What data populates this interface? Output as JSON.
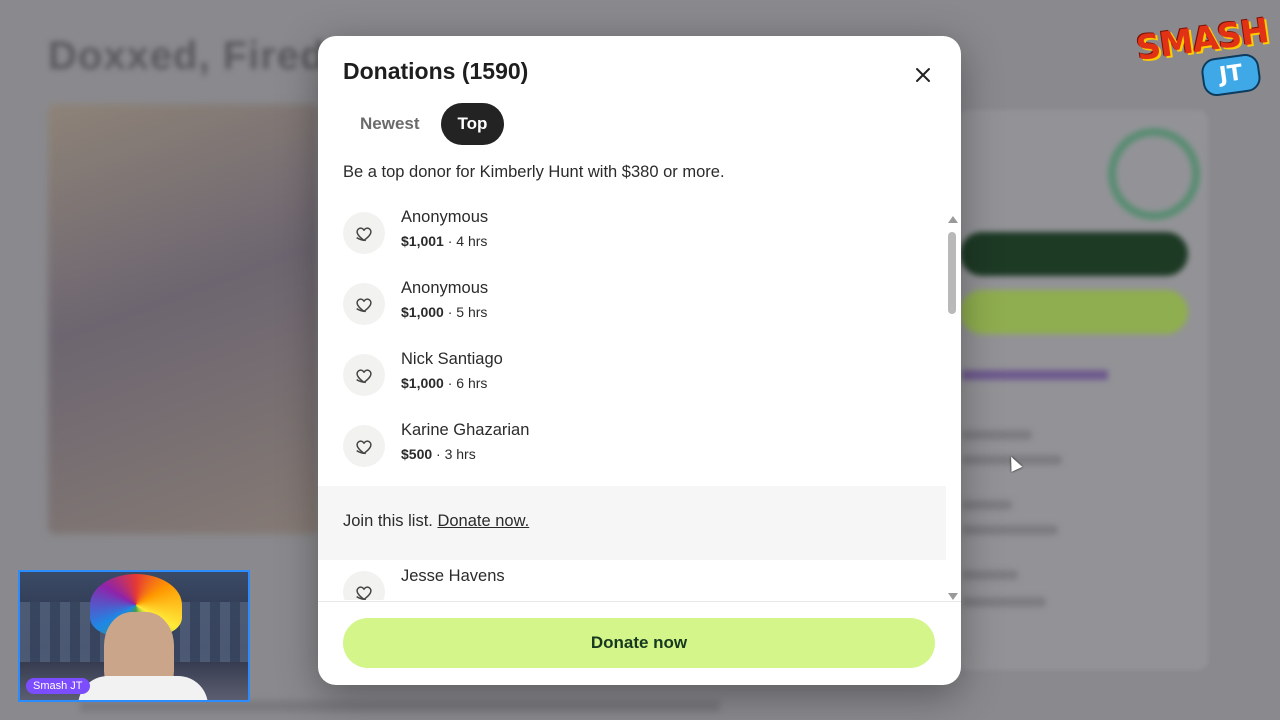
{
  "background": {
    "page_title": "Doxxed, Fired,"
  },
  "logo": {
    "main": "SMASH",
    "sub": "JT"
  },
  "webcam": {
    "label": "Smash JT"
  },
  "modal": {
    "title": "Donations (1590)",
    "tabs": [
      {
        "label": "Newest",
        "active": false
      },
      {
        "label": "Top",
        "active": true
      }
    ],
    "top_note": "Be a top donor for Kimberly Hunt with $380 or more.",
    "donors": [
      {
        "name": "Anonymous",
        "amount": "$1,001",
        "time": "· 4 hrs"
      },
      {
        "name": "Anonymous",
        "amount": "$1,000",
        "time": "· 5 hrs"
      },
      {
        "name": "Nick Santiago",
        "amount": "$1,000",
        "time": "· 6 hrs"
      },
      {
        "name": "Karine Ghazarian",
        "amount": "$500",
        "time": "· 3 hrs"
      },
      {
        "name": "Jesse Havens",
        "amount": "",
        "time": ""
      }
    ],
    "join": {
      "text": "Join this list.",
      "link": "Donate now."
    },
    "donate_button": "Donate now",
    "colors": {
      "active_tab": "#232323",
      "donate_button": "#d4f58a",
      "donate_text": "#16391f"
    }
  }
}
